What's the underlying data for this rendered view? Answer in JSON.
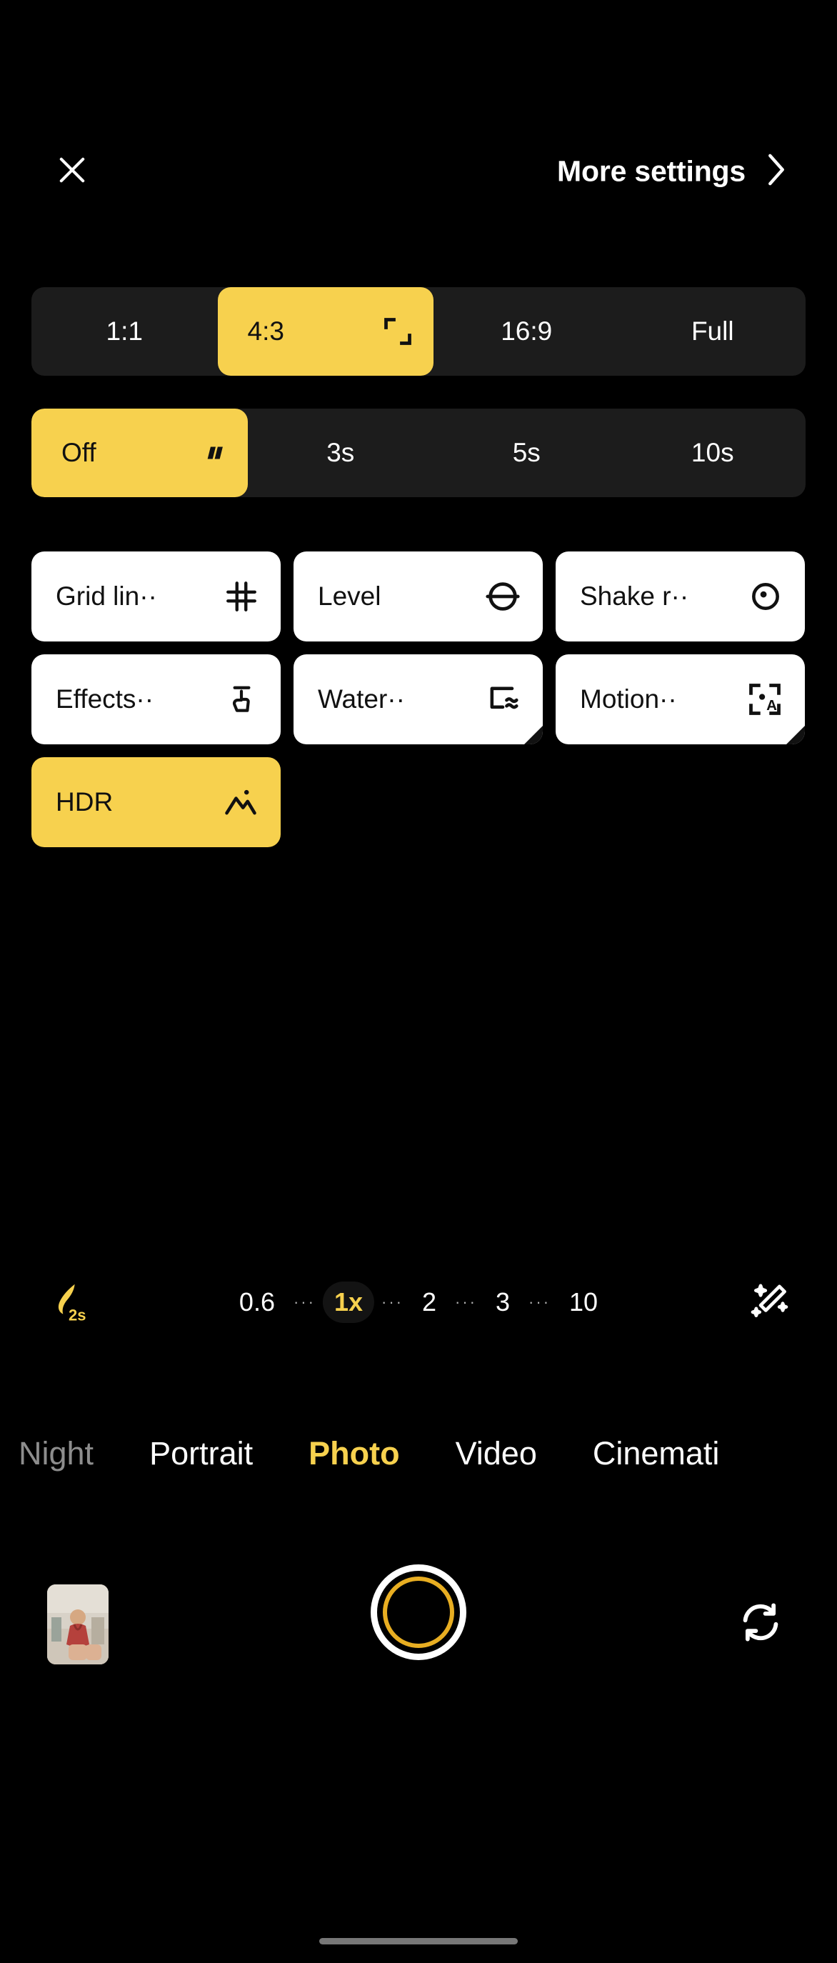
{
  "theme": {
    "background": "#000000",
    "accent": "#F7D14E",
    "panel": "#1c1c1c",
    "pill_bg": "#ffffff",
    "text_on_dark": "#ffffff",
    "text_on_light": "#111111",
    "dim_text": "#8d8d8d"
  },
  "header": {
    "close_icon": "close-icon",
    "more_settings_label": "More settings",
    "chevron_icon": "chevron-right-icon"
  },
  "aspect_ratio": {
    "name": "aspect-ratio-selector",
    "selected": "4:3",
    "options": [
      {
        "label": "1:1",
        "icon": "",
        "selected": false
      },
      {
        "label": "4:3",
        "icon": "crop-corners-icon",
        "selected": true
      },
      {
        "label": "16:9",
        "icon": "",
        "selected": false
      },
      {
        "label": "Full",
        "icon": "",
        "selected": false
      }
    ]
  },
  "timer": {
    "name": "timer-selector",
    "selected": "Off",
    "options": [
      {
        "label": "Off",
        "icon": "timer-off-icon",
        "selected": true
      },
      {
        "label": "3s",
        "icon": "",
        "selected": false
      },
      {
        "label": "5s",
        "icon": "",
        "selected": false
      },
      {
        "label": "10s",
        "icon": "",
        "selected": false
      }
    ]
  },
  "features": [
    {
      "label": "Grid lin··",
      "icon": "grid-lines-icon",
      "selected": false,
      "has_corner": false
    },
    {
      "label": "Level",
      "icon": "level-icon",
      "selected": false,
      "has_corner": false
    },
    {
      "label": "Shake r··",
      "icon": "shake-reduce-icon",
      "selected": false,
      "has_corner": false
    },
    {
      "label": "Effects··",
      "icon": "effects-hand-icon",
      "selected": false,
      "has_corner": false
    },
    {
      "label": "Water··",
      "icon": "watermark-icon",
      "selected": false,
      "has_corner": true
    },
    {
      "label": "Motion··",
      "icon": "motion-auto-icon",
      "selected": false,
      "has_corner": true
    },
    {
      "label": "HDR",
      "icon": "hdr-landscape-icon",
      "selected": true,
      "has_corner": false
    }
  ],
  "zoom_bar": {
    "night_icon": "night-moon-icon",
    "night_label": "2s",
    "wand_icon": "magic-wand-icon",
    "selected": "1x",
    "steps": [
      {
        "label": "0.6",
        "active": false
      },
      {
        "label": "1x",
        "active": true
      },
      {
        "label": "2",
        "active": false
      },
      {
        "label": "3",
        "active": false
      },
      {
        "label": "10",
        "active": false
      }
    ],
    "separator": "···"
  },
  "modes": {
    "selected": "Photo",
    "tabs": [
      {
        "label": "Night",
        "state": "dim"
      },
      {
        "label": "Portrait",
        "state": "normal"
      },
      {
        "label": "Photo",
        "state": "active"
      },
      {
        "label": "Video",
        "state": "normal"
      },
      {
        "label": "Cinemati",
        "state": "clipped"
      }
    ]
  },
  "capture_bar": {
    "thumbnail_name": "gallery-thumbnail",
    "shutter_name": "shutter-button",
    "flip_icon": "flip-camera-icon"
  }
}
